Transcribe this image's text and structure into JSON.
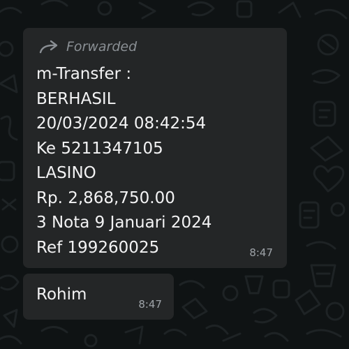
{
  "conversation": {
    "messages": [
      {
        "forwarded_label": "Forwarded",
        "lines": [
          "m-Transfer :",
          "BERHASIL",
          "20/03/2024 08:42:54",
          "Ke 5211347105",
          "LASINO",
          "Rp. 2,868,750.00",
          "3 Nota 9 Januari 2024",
          "Ref 199260025"
        ],
        "time": "8:47"
      },
      {
        "text": "Rohim",
        "time": "8:47"
      }
    ]
  },
  "colors": {
    "chat_background": "#0f1314",
    "bubble_background": "#242627",
    "message_text": "#f3f3f4",
    "meta_text": "#9ea3a8"
  },
  "icons": {
    "forwarded": "forward-arrow-icon"
  }
}
